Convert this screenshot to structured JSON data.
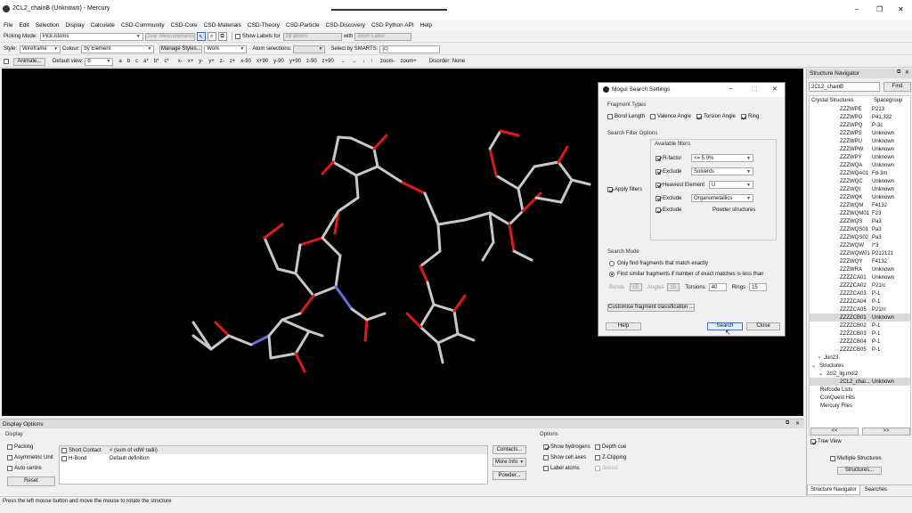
{
  "title": "2CL2_chainB (Unknown) - Mercury",
  "window_controls": [
    "–",
    "❐",
    "✕"
  ],
  "menu": [
    "File",
    "Edit",
    "Selection",
    "Display",
    "Calculate",
    "CSD-Community",
    "CSD-Core",
    "CSD-Materials",
    "CSD-Theory",
    "CSD-Particle",
    "CSD-Discovery",
    "CSD Python API",
    "Help"
  ],
  "toolbar1": {
    "picking_mode_label": "Picking Mode:",
    "picking_mode_value": "Pick Atoms",
    "clear_measurements": "Clear Measurements",
    "show_labels": "Show Labels for",
    "show_labels_value": "All atoms",
    "with_label": "with",
    "with_value": "Atom Label"
  },
  "toolbar2": {
    "style_label": "Style:",
    "style_value": "Wireframe",
    "colour_label": "Colour:",
    "colour_value": "by Element",
    "manage_styles": "Manage Styles...",
    "manage_styles_value": "Work",
    "atom_selections": "Atom selections:",
    "select_smarts": "Select by SMARTS:",
    "smarts_value": "[c]"
  },
  "toolbar3": {
    "animate": "Animate...",
    "default_view_label": "Default view:",
    "default_view_value": "b",
    "axes": [
      "a",
      "b",
      "c",
      "a*",
      "b*",
      "c*"
    ],
    "rotations": [
      "x-",
      "x+",
      "y-",
      "y+",
      "z-",
      "z+",
      "x-90",
      "x+90",
      "y-90",
      "y+90",
      "z-90",
      "z+90"
    ],
    "arrows": [
      "←",
      "→",
      "↓",
      "↑"
    ],
    "zoom": [
      "zoom-",
      "zoom+"
    ],
    "disorder": "Disorder: None"
  },
  "dialog": {
    "title": "Mogul Search Settings",
    "fragment_types_label": "Fragment Types",
    "fragment_types": [
      {
        "label": "Bond Length",
        "checked": false
      },
      {
        "label": "Valence Angle",
        "checked": false
      },
      {
        "label": "Torsion Angle",
        "checked": true
      },
      {
        "label": "Ring",
        "checked": true
      }
    ],
    "search_filter_label": "Search Filter Options",
    "available_filters": "Available filters",
    "apply_filters": "Apply filters",
    "filters": [
      {
        "label": "R-factor",
        "value": "<= 5.0%",
        "checked": true
      },
      {
        "label": "Exclude",
        "value": "Solvents",
        "checked": true
      },
      {
        "label": "Heaviest Element",
        "value": "U",
        "checked": true
      },
      {
        "label": "Exclude",
        "value": "Organometallics",
        "checked": true
      },
      {
        "label": "Exclude",
        "value": "Powder structures",
        "checked": true
      }
    ],
    "search_mode_label": "Search Mode",
    "mode_exact": "Only find fragments that match exactly",
    "mode_similar": "Find similar fragments if number of exact matches is less than",
    "bonds_label": "Bonds",
    "bonds_value": "15",
    "angles_label": "Angles",
    "angles_value": "15",
    "torsions_label": "Torsions",
    "torsions_value": "40",
    "rings_label": "Rings",
    "rings_value": "15",
    "customise": "Customise fragment classification ...",
    "help": "Help",
    "search": "Search",
    "close": "Close"
  },
  "navigator": {
    "title": "Structure Navigator",
    "search_value": "2CL2_chainB",
    "find": "Find",
    "col_structures": "Crystal Structures",
    "col_spacegroup": "Spacegroup",
    "entries": [
      {
        "name": "ZZZWPE",
        "sg": "P213"
      },
      {
        "name": "ZZZWPO",
        "sg": "P41,332"
      },
      {
        "name": "ZZZWPQ",
        "sg": "P-3c"
      },
      {
        "name": "ZZZWPS",
        "sg": "Unknown"
      },
      {
        "name": "ZZZWPU",
        "sg": "Unknown"
      },
      {
        "name": "ZZZWPW",
        "sg": "Unknown"
      },
      {
        "name": "ZZZWPY",
        "sg": "Unknown"
      },
      {
        "name": "ZZZWQA",
        "sg": "Unknown"
      },
      {
        "name": "ZZZWQA01",
        "sg": "Fd-3m"
      },
      {
        "name": "ZZZWQC",
        "sg": "Unknown"
      },
      {
        "name": "ZZZWQI",
        "sg": "Unknown"
      },
      {
        "name": "ZZZWQK",
        "sg": "Unknown"
      },
      {
        "name": "ZZZWQM",
        "sg": "F4132"
      },
      {
        "name": "ZZZWQM01",
        "sg": "F23"
      },
      {
        "name": "ZZZWQS",
        "sg": "Pa3"
      },
      {
        "name": "ZZZWQS01",
        "sg": "Pa3"
      },
      {
        "name": "ZZZWQS02",
        "sg": "Pa3"
      },
      {
        "name": "ZZZWQW",
        "sg": "I*3"
      },
      {
        "name": "ZZZWQW01",
        "sg": "P212121"
      },
      {
        "name": "ZZZWQY",
        "sg": "F4132"
      },
      {
        "name": "ZZZWRA",
        "sg": "Unknown"
      },
      {
        "name": "ZZZZCA01",
        "sg": "Unknown"
      },
      {
        "name": "ZZZZCA02",
        "sg": "P21/c"
      },
      {
        "name": "ZZZZCA03",
        "sg": "P-1"
      },
      {
        "name": "ZZZZCA04",
        "sg": "P-1"
      },
      {
        "name": "ZZZZCA05",
        "sg": "P21/n"
      },
      {
        "name": "ZZZZCB01",
        "sg": "Unknown"
      },
      {
        "name": "ZZZZCB02",
        "sg": "P-1"
      },
      {
        "name": "ZZZZCB03",
        "sg": "P-1"
      },
      {
        "name": "ZZZZCB04",
        "sg": "P-1"
      },
      {
        "name": "ZZZZCB05",
        "sg": "P-1"
      }
    ],
    "folder_jun23": "Jun23",
    "folder_structures": "Structures",
    "file": "2cl2_lig.mol2",
    "file_entry": "2CL2_chai...",
    "file_entry_sg": "Unknown",
    "refcode_lists": "Refcode Lists",
    "conquest_hits": "ConQuest Hits",
    "mercury_files": "Mercury Files",
    "prev": "<<",
    "next": ">>",
    "tree_view": "Tree View",
    "multiple_structures": "Multiple Structures",
    "structures_btn": "Structures...",
    "tab_navigator": "Structure Navigator",
    "tab_searches": "Searches"
  },
  "display_options": {
    "title": "Display Options",
    "display_label": "Display",
    "packing": "Packing",
    "asym_unit": "Asymmetric Unit",
    "auto_centre": "Auto centre",
    "reset": "Reset",
    "contacts": [
      {
        "name": "Short Contact",
        "desc": "< (sum of vdW radii)"
      },
      {
        "name": "H-Bond",
        "desc": "Default definition"
      }
    ],
    "contacts_btn": "Contacts...",
    "more_info": "More Info",
    "powder": "Powder...",
    "options_label": "Options",
    "show_hydrogens": "Show hydrogens",
    "depth_cue": "Depth cue",
    "show_cell_axes": "Show cell axes",
    "z_clipping": "Z-Clipping",
    "label_atoms": "Label atoms",
    "stereo": "Stereo"
  },
  "status": "Press the left mouse button and move the mouse to rotate the structure",
  "colors": {
    "bond_grey": "#c8c8c8",
    "oxygen": "#e01818",
    "nitrogen": "#6a6ad8",
    "viewport": "#000000"
  }
}
